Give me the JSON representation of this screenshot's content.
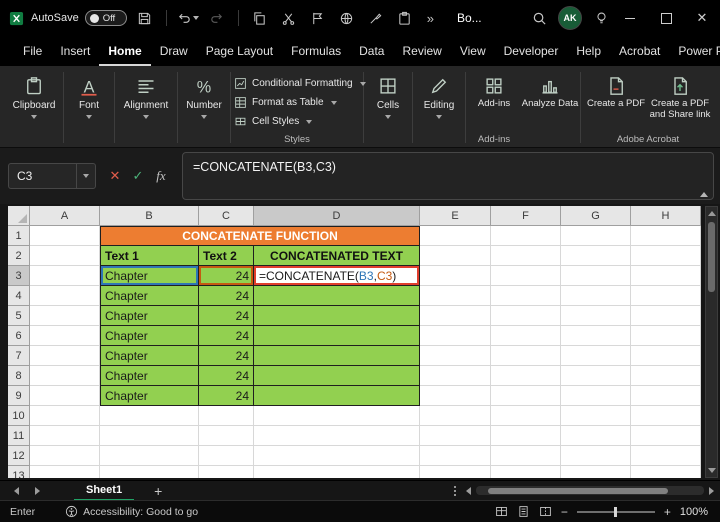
{
  "titlebar": {
    "autosave_label": "AutoSave",
    "autosave_state": "Off",
    "more_commands": "»",
    "doc_title": "Bo...",
    "account_initials": "AK"
  },
  "menubar": {
    "items": [
      "File",
      "Insert",
      "Home",
      "Draw",
      "Page Layout",
      "Formulas",
      "Data",
      "Review",
      "View",
      "Developer",
      "Help",
      "Acrobat",
      "Power Pivot"
    ],
    "active_item": "Home"
  },
  "ribbon": {
    "clipboard_label": "Clipboard",
    "font_label": "Font",
    "alignment_label": "Alignment",
    "number_label": "Number",
    "styles_items": [
      "Conditional Formatting",
      "Format as Table",
      "Cell Styles"
    ],
    "styles_group_label": "Styles",
    "cells_label": "Cells",
    "editing_label": "Editing",
    "addins_button_label": "Add-ins",
    "addins_group_label": "Add-ins",
    "analyze_data_label": "Analyze Data",
    "create_pdf_label": "Create a PDF",
    "create_pdf_share_label": "Create a PDF and Share link",
    "acrobat_group_label": "Adobe Acrobat"
  },
  "formula_bar": {
    "name_box_value": "C3",
    "formula": "=CONCATENATE(B3,C3)"
  },
  "grid": {
    "column_letters": [
      "A",
      "B",
      "C",
      "D",
      "E",
      "F",
      "G",
      "H"
    ],
    "row_numbers": [
      "1",
      "2",
      "3",
      "4",
      "5",
      "6",
      "7",
      "8",
      "9",
      "10",
      "11",
      "12",
      "13"
    ],
    "selected_column": "D",
    "selected_row": "3",
    "banner_text": "CONCATENATE FUNCTION",
    "header_text1": "Text 1",
    "header_text2": "Text 2",
    "header_concat": "CONCATENATED TEXT",
    "data_rows": [
      {
        "text1": "Chapter",
        "text2": "24"
      },
      {
        "text1": "Chapter",
        "text2": "24"
      },
      {
        "text1": "Chapter",
        "text2": "24"
      },
      {
        "text1": "Chapter",
        "text2": "24"
      },
      {
        "text1": "Chapter",
        "text2": "24"
      },
      {
        "text1": "Chapter",
        "text2": "24"
      },
      {
        "text1": "Chapter",
        "text2": "24"
      }
    ],
    "formula_cell": {
      "p1": "=CONCATENATE(",
      "ref1": "B3",
      "p2": ",",
      "ref2": "C3",
      "p3": ")"
    }
  },
  "sheet_bar": {
    "active_tab": "Sheet1",
    "add_sheet": "+"
  },
  "status_bar": {
    "mode": "Enter",
    "accessibility_text": "Accessibility: Good to go",
    "zoom_level": "100%"
  },
  "colors": {
    "excel_green": "#21A366",
    "banner_orange": "#ED7D31",
    "table_green": "#92D050",
    "ref_blue": "#2E75B6",
    "ref_orange": "#C55A11",
    "edit_border_red": "#E03E2D"
  }
}
